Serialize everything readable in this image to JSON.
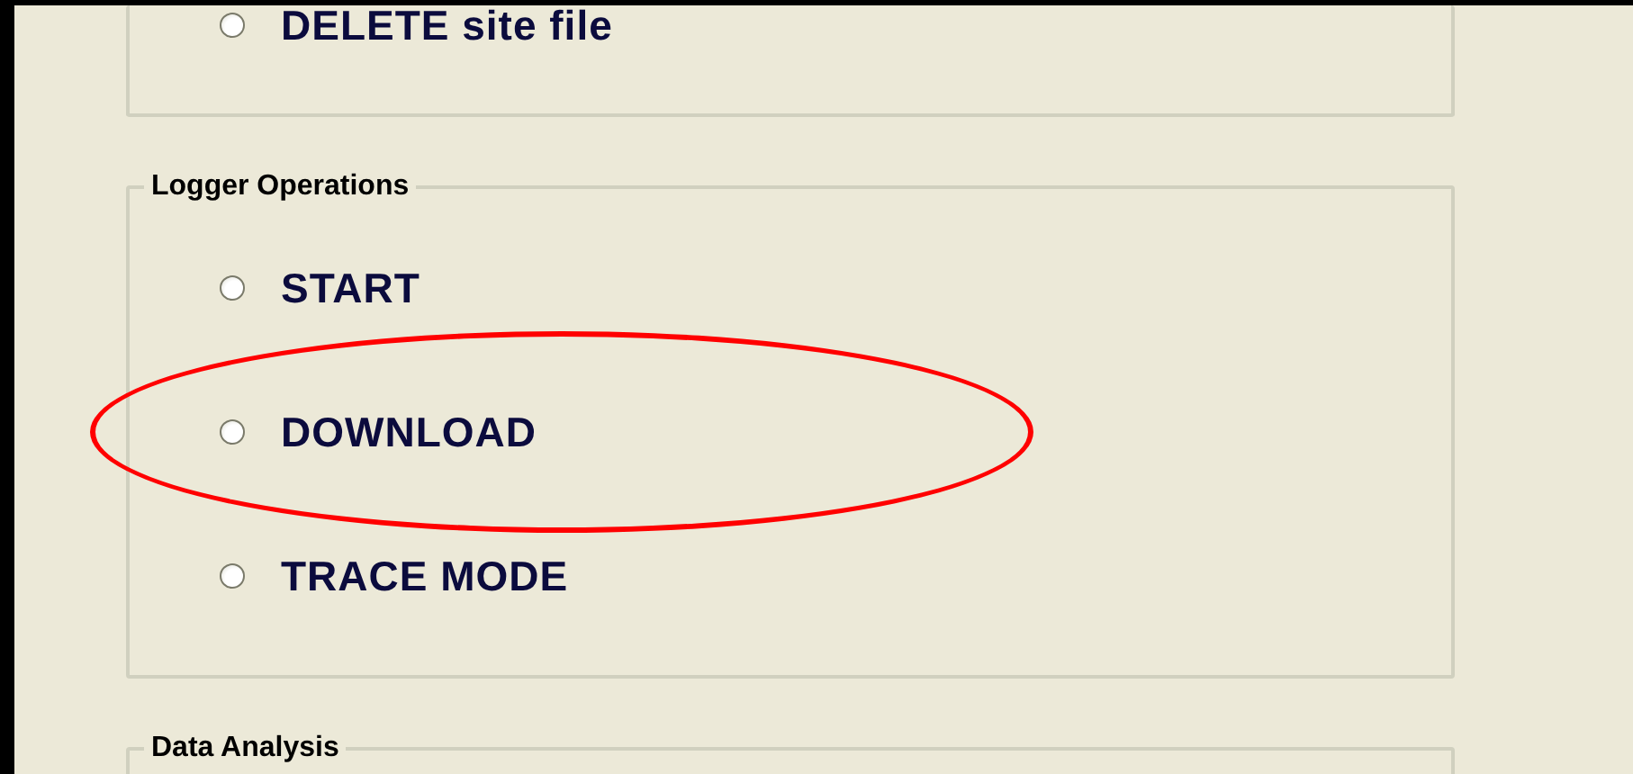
{
  "groups": [
    {
      "options": [
        {
          "label": "DELETE site file",
          "selected": false,
          "highlighted": false
        }
      ]
    },
    {
      "title": "Logger Operations",
      "options": [
        {
          "label": "START",
          "selected": false,
          "highlighted": false
        },
        {
          "label": "DOWNLOAD",
          "selected": false,
          "highlighted": true
        },
        {
          "label": "TRACE MODE",
          "selected": false,
          "highlighted": false
        }
      ]
    },
    {
      "title": "Data Analysis"
    }
  ]
}
